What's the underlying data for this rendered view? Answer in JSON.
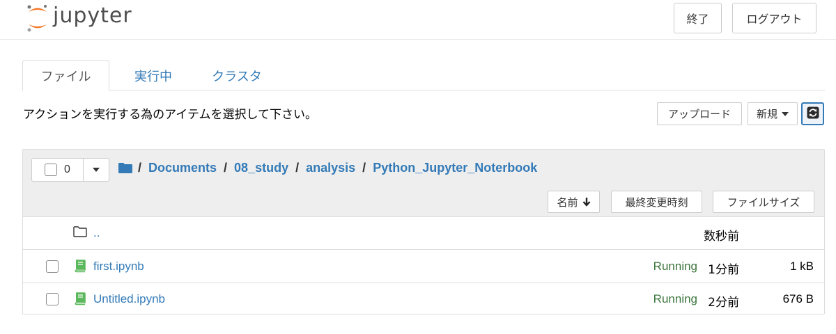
{
  "header": {
    "logo_text": "jupyter",
    "quit_label": "終了",
    "logout_label": "ログアウト"
  },
  "tabs": [
    {
      "label": "ファイル",
      "active": true
    },
    {
      "label": "実行中",
      "active": false
    },
    {
      "label": "クラスタ",
      "active": false
    }
  ],
  "toolbar": {
    "instruction": "アクションを実行する為のアイテムを選択して下さい。",
    "upload_label": "アップロード",
    "new_label": "新規"
  },
  "file_list": {
    "selected_count": "0",
    "breadcrumb": [
      "Documents",
      "08_study",
      "analysis",
      "Python_Jupyter_Noterbook"
    ],
    "breadcrumb_sep": "/",
    "sort_name_label": "名前",
    "sort_modified_label": "最終変更時刻",
    "sort_size_label": "ファイルサイズ",
    "parent": {
      "name": "..",
      "modified": "数秒前"
    },
    "items": [
      {
        "name": "first.ipynb",
        "status": "Running",
        "modified": "1分前",
        "size": "1 kB"
      },
      {
        "name": "Untitled.ipynb",
        "status": "Running",
        "modified": "2分前",
        "size": "676 B"
      }
    ]
  },
  "colors": {
    "link": "#337ab7",
    "running": "#3c763d",
    "notebook_icon": "#5cb85c",
    "logo_orange": "#f37726"
  },
  "icons": {
    "logo": "jupyter-logo-icon",
    "folder": "folder-icon",
    "notebook": "notebook-icon",
    "sort": "arrow-down-icon",
    "refresh": "refresh-icon"
  }
}
